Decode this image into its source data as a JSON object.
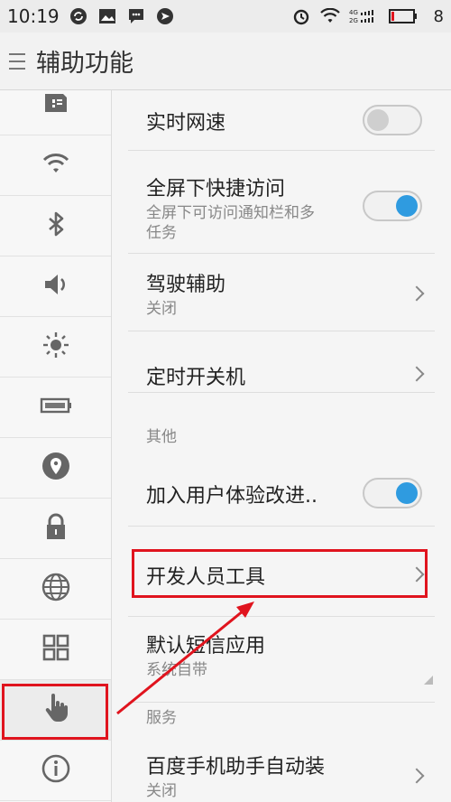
{
  "status_bar": {
    "time": "10:19",
    "battery_level": "8"
  },
  "header": {
    "title": "辅助功能"
  },
  "sidebar": {
    "items": [
      {
        "icon": "sim-card-icon"
      },
      {
        "icon": "wifi-icon"
      },
      {
        "icon": "bluetooth-icon"
      },
      {
        "icon": "speaker-icon"
      },
      {
        "icon": "brightness-icon"
      },
      {
        "icon": "battery-icon"
      },
      {
        "icon": "location-icon"
      },
      {
        "icon": "lock-icon"
      },
      {
        "icon": "globe-icon"
      },
      {
        "icon": "apps-grid-icon"
      },
      {
        "icon": "hand-pointer-icon"
      },
      {
        "icon": "info-icon"
      }
    ]
  },
  "settings": {
    "realtime_speed": {
      "label": "实时网速",
      "toggle": "off"
    },
    "fullscreen_access": {
      "label": "全屏下快捷访问",
      "sub1": "全屏下可访问通知栏和多",
      "sub2": "任务",
      "toggle": "on"
    },
    "driving_assist": {
      "label": "驾驶辅助",
      "sub": "关闭"
    },
    "timed_power": {
      "label": "定时开关机"
    },
    "section_other": "其他",
    "ux_program": {
      "label": "加入用户体验改进..",
      "toggle": "on"
    },
    "developer_tools": {
      "label": "开发人员工具"
    },
    "default_sms": {
      "label": "默认短信应用",
      "sub": "系统自带"
    },
    "section_service": "服务",
    "baidu_autoinstall": {
      "label": "百度手机助手自动装",
      "sub": "关闭"
    }
  },
  "colors": {
    "highlight": "#e0141e",
    "toggle_on": "#2f9be0"
  }
}
